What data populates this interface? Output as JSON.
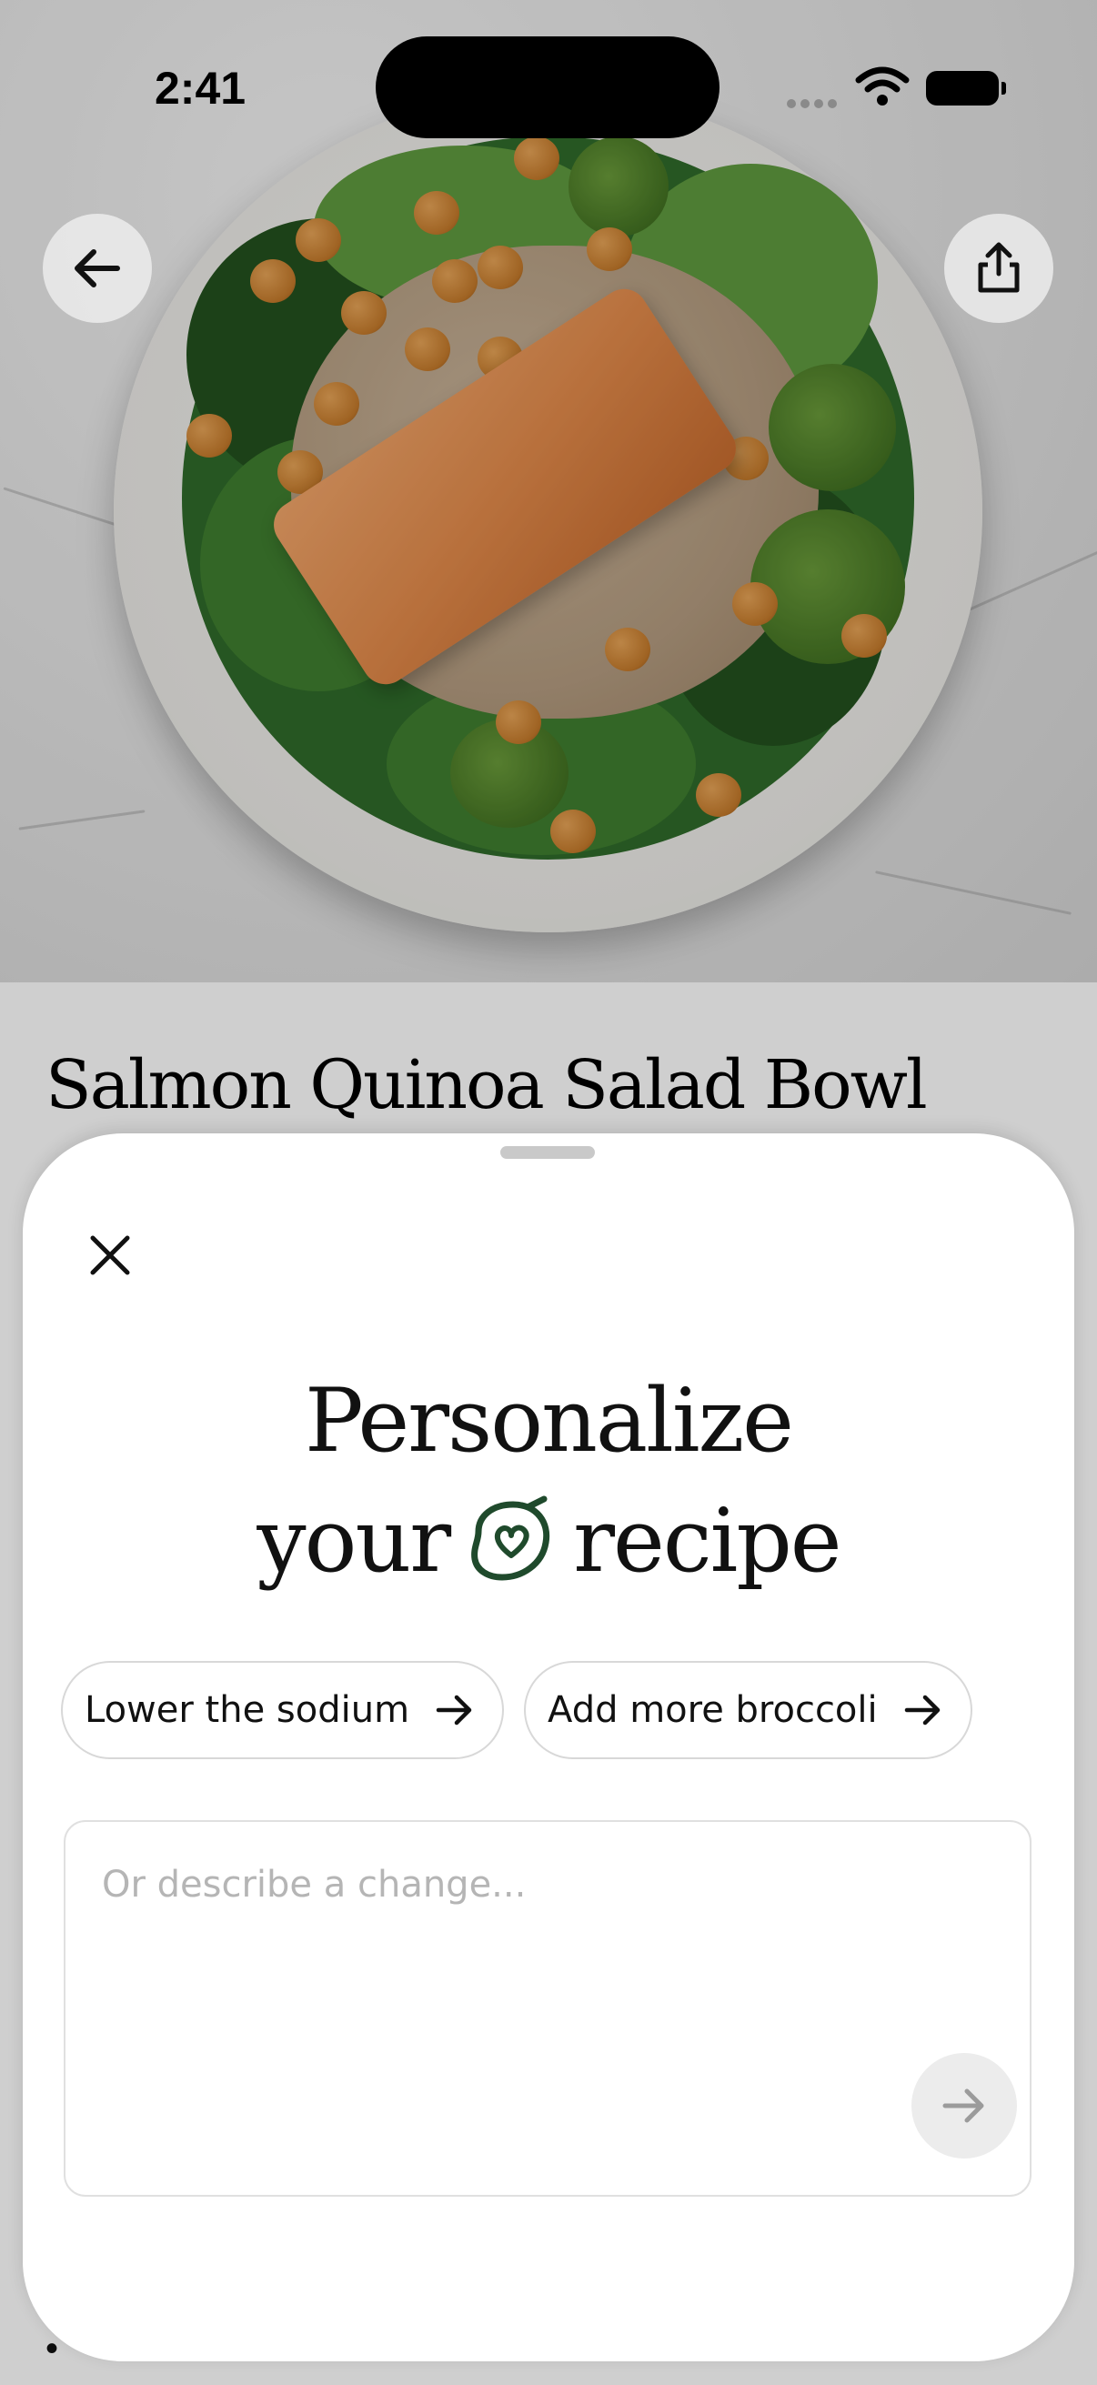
{
  "status_bar": {
    "time": "2:41"
  },
  "recipe": {
    "title": "Salmon Quinoa Salad Bowl",
    "bullet_peek": "•"
  },
  "nav": {
    "back_icon": "arrow-left-icon",
    "share_icon": "share-icon"
  },
  "sheet": {
    "heading_line1": "Personalize",
    "heading_word_before_icon": "your",
    "heading_word_after_icon": "recipe",
    "accent_color": "#1f4a2c",
    "suggestions": [
      {
        "label": "Lower the sodium"
      },
      {
        "label": "Add more broccoli"
      }
    ],
    "input": {
      "placeholder": "Or describe a change...",
      "value": ""
    },
    "send_icon": "arrow-right-icon"
  }
}
